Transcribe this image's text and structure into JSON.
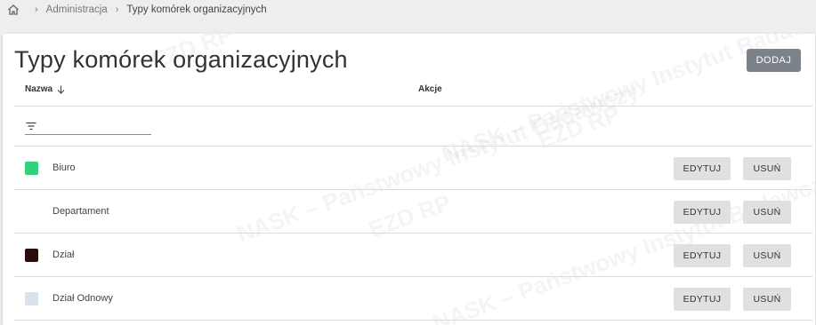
{
  "breadcrumb": {
    "home_icon": "home-icon",
    "separator": "›",
    "items": [
      "Administracja",
      "Typy komórek organizacyjnych"
    ]
  },
  "page": {
    "title": "Typy komórek organizacyjnych",
    "add_button": "DODAJ"
  },
  "table": {
    "columns": {
      "name": "Nazwa",
      "actions": "Akcje"
    },
    "sort_icon": "arrow-down-icon",
    "filter": {
      "icon": "filter-icon",
      "value": "",
      "placeholder": ""
    },
    "rows": [
      {
        "name": "Biuro",
        "color": "#33d17a",
        "edit_label": "EDYTUJ",
        "delete_label": "USUŃ"
      },
      {
        "name": "Departament",
        "color": "",
        "edit_label": "EDYTUJ",
        "delete_label": "USUŃ"
      },
      {
        "name": "Dział",
        "color": "#2b0c0c",
        "edit_label": "EDYTUJ",
        "delete_label": "USUŃ"
      },
      {
        "name": "Dział Odnowy",
        "color": "#d6e2ef",
        "edit_label": "EDYTUJ",
        "delete_label": "USUŃ"
      }
    ]
  },
  "watermark": {
    "text": "NASK – Państwowy Instytut Badawczy",
    "logo": "EZD RP"
  },
  "colors": {
    "background": "#eeeeee",
    "card": "#ffffff",
    "primary_button": "#7c8289",
    "secondary_button": "#e0e0e0"
  }
}
